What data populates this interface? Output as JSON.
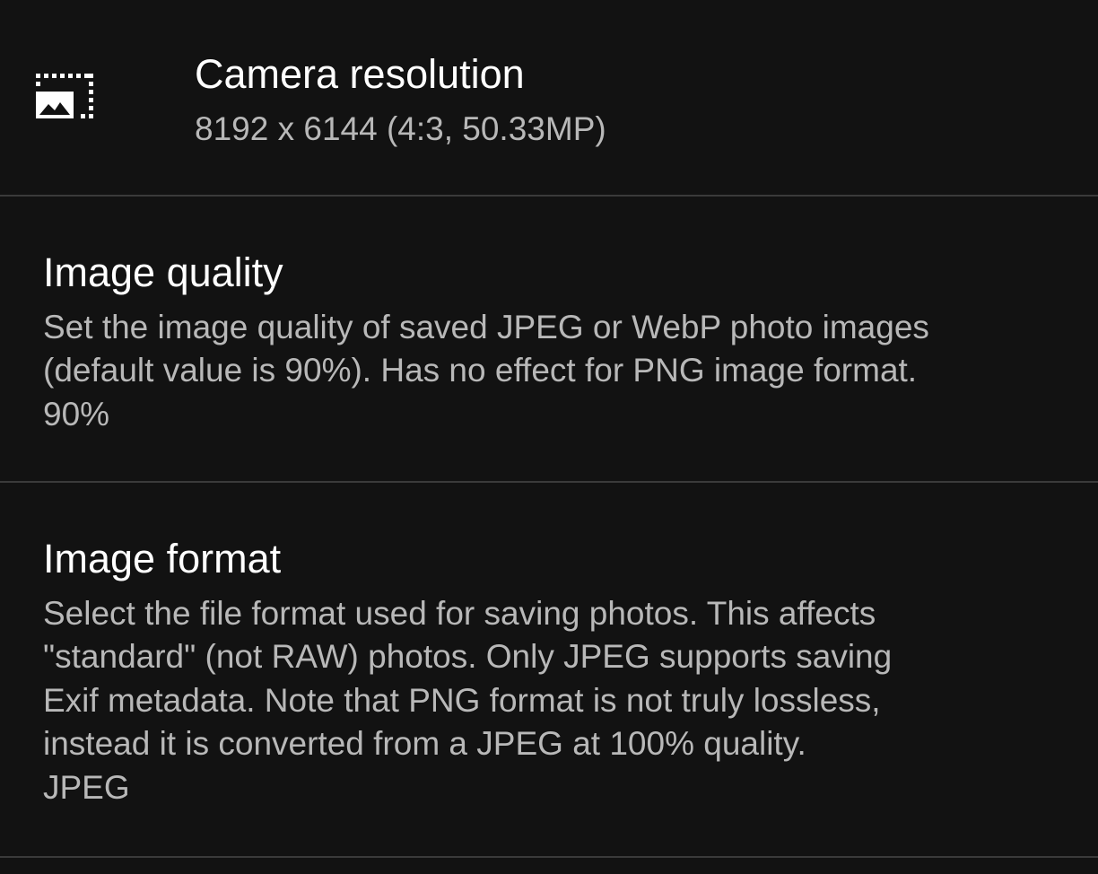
{
  "settings": [
    {
      "icon": "photo-size-select-icon",
      "title": "Camera resolution",
      "summary_lines": [
        "8192 x 6144 (4:3, 50.33MP)"
      ]
    },
    {
      "title": "Image quality",
      "summary_lines": [
        "Set the image quality of saved JPEG or WebP photo images",
        "(default value is 90%). Has no effect for PNG image format.",
        "90%"
      ]
    },
    {
      "title": "Image format",
      "summary_lines": [
        "Select the file format used for saving photos. This affects",
        "\"standard\" (not RAW) photos. Only JPEG supports saving",
        "Exif metadata. Note that PNG format is not truly lossless,",
        "instead it is converted from a JPEG at 100% quality.",
        "JPEG"
      ]
    }
  ]
}
